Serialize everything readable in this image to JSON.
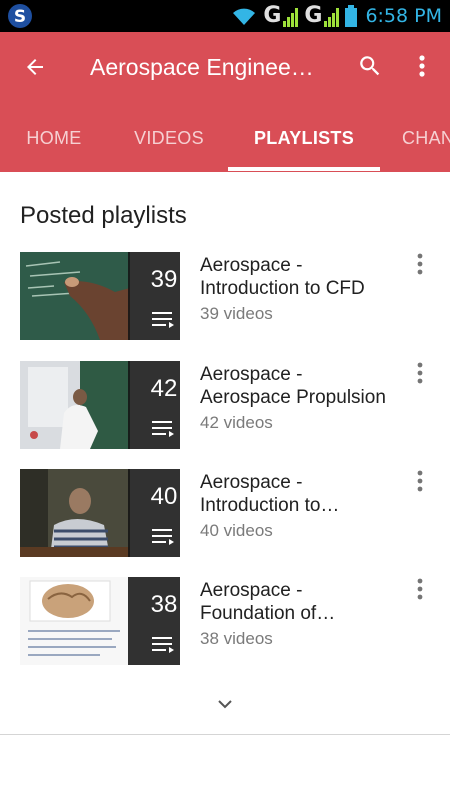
{
  "status_bar": {
    "time": "6:58 PM",
    "network_label_1": "G",
    "network_label_2": "G",
    "icons": [
      "app-s-icon",
      "wifi-icon",
      "signal-icon",
      "signal-icon",
      "battery-icon"
    ]
  },
  "header": {
    "title": "Aerospace Enginee…",
    "icons": {
      "back": "back-arrow-icon",
      "search": "search-icon",
      "more": "more-vert-icon"
    },
    "colors": {
      "appbar": "#d94e56",
      "tab_inactive": "#f6d0d2",
      "tab_active": "#ffffff"
    }
  },
  "tabs": [
    {
      "label": "HOME",
      "active": false
    },
    {
      "label": "VIDEOS",
      "active": false
    },
    {
      "label": "PLAYLISTS",
      "active": true
    },
    {
      "label": "CHAN",
      "active": false
    }
  ],
  "main": {
    "section_title": "Posted playlists",
    "playlists": [
      {
        "count": "39",
        "title_line1": "Aerospace -",
        "title_line2": "Introduction to CFD",
        "subtitle": "39 videos"
      },
      {
        "count": "42",
        "title_line1": "Aerospace -",
        "title_line2": "Aerospace Propulsion",
        "subtitle": "42 videos"
      },
      {
        "count": "40",
        "title_line1": "Aerospace -",
        "title_line2": "Introduction to…",
        "subtitle": "40 videos"
      },
      {
        "count": "38",
        "title_line1": "Aerospace -",
        "title_line2": "Foundation of…",
        "subtitle": "38 videos"
      }
    ],
    "expand_icon": "chevron-down-icon"
  }
}
